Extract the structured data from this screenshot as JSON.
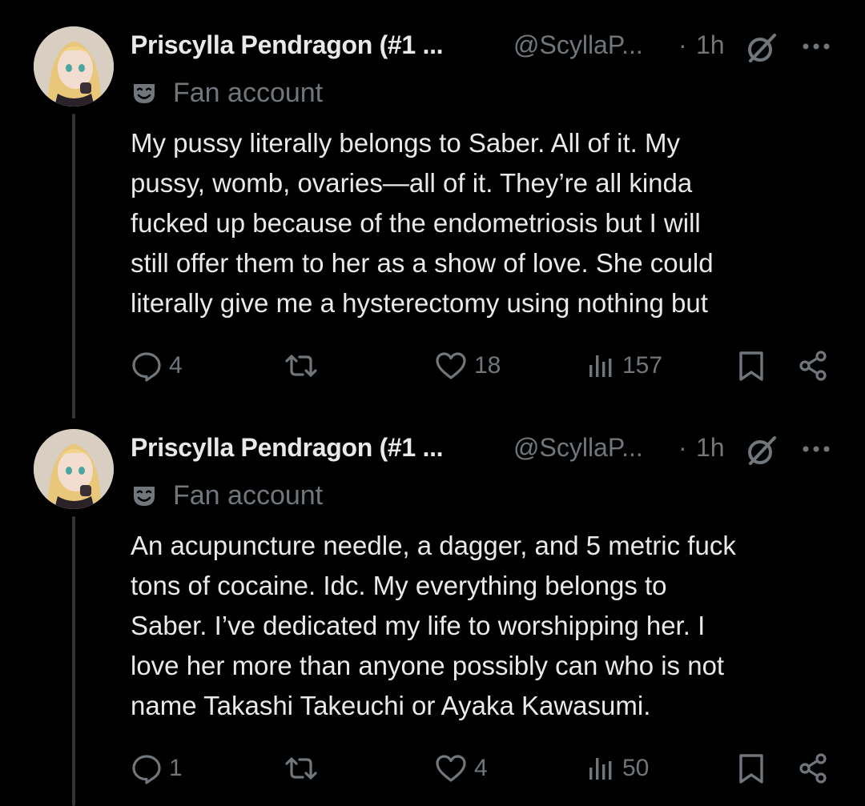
{
  "colors": {
    "background": "#000000",
    "primary_text": "#e7e9ea",
    "secondary_text": "#71767b",
    "thread_line": "#333639"
  },
  "tweets": [
    {
      "display_name": "Priscylla Pendragon (#1 ...",
      "handle": "@ScyllaP...",
      "separator": "·",
      "time": "1h",
      "label": "Fan account",
      "label_icon": "mask-icon",
      "text_lines": [
        "My pussy literally belongs to Saber. All of it. My",
        "pussy, womb, ovaries—all of it. They’re all kinda",
        "fucked up because of the endometriosis but I will",
        "still offer them to her as a show of love. She could",
        "literally give me a hysterectomy using nothing but"
      ],
      "replies": "4",
      "retweets": "",
      "likes": "18",
      "views": "157"
    },
    {
      "display_name": "Priscylla Pendragon (#1 ...",
      "handle": "@ScyllaP...",
      "separator": "·",
      "time": "1h",
      "label": "Fan account",
      "label_icon": "mask-icon",
      "text_lines": [
        "An acupuncture needle, a dagger, and 5 metric fuck",
        "tons of cocaine. Idc. My everything belongs to",
        "Saber. I’ve dedicated my life to worshipping her. I",
        "love her more than anyone possibly can who is not",
        "name Takashi Takeuchi or Ayaka Kawasumi."
      ],
      "replies": "1",
      "retweets": "",
      "likes": "4",
      "views": "50"
    }
  ]
}
